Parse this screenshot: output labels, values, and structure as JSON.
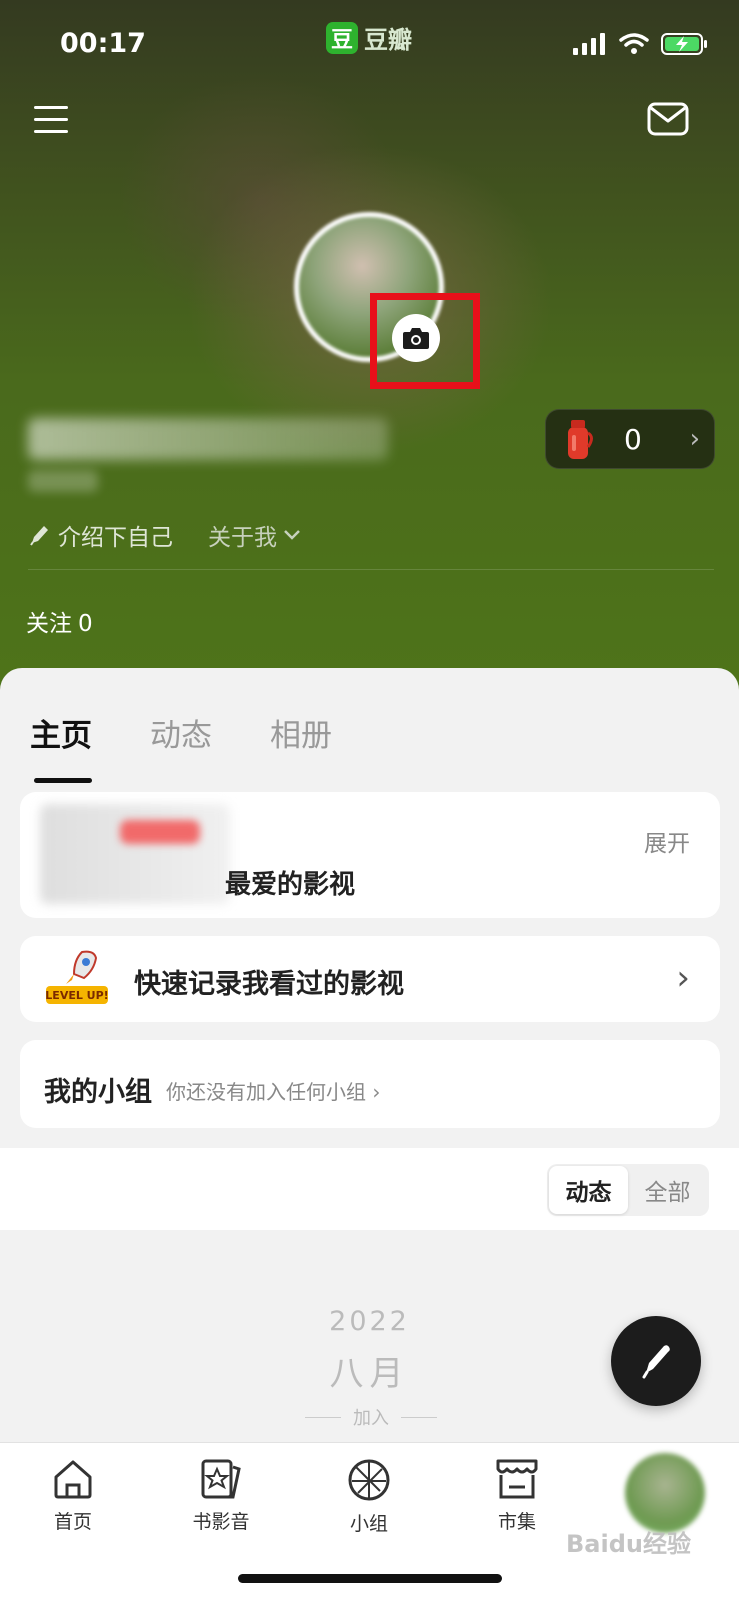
{
  "status_bar": {
    "time": "00:17",
    "app_badge": "豆瓣",
    "app_logo_char": "豆"
  },
  "header": {
    "menu_icon": "hamburger-icon",
    "mail_icon": "mail-icon"
  },
  "profile": {
    "camera_icon": "camera-icon",
    "points_value": "0",
    "intro_label": "介绍下自己",
    "about_label": "关于我",
    "follow_label": "关注",
    "follow_count": "0"
  },
  "tabs": [
    {
      "label": "主页",
      "active": true
    },
    {
      "label": "动态",
      "active": false
    },
    {
      "label": "相册",
      "active": false
    }
  ],
  "cards": {
    "favorites_text": "最爱的影视",
    "expand_label": "展开",
    "quick_record_label": "快速记录我看过的影视",
    "level_up_text": "LEVEL UP!",
    "groups_title": "我的小组",
    "groups_subtitle": "你还没有加入任何小组"
  },
  "filter": {
    "options": [
      "动态",
      "全部"
    ],
    "selected": "动态"
  },
  "timeline": {
    "year": "2022",
    "month": "八月",
    "event": "加入"
  },
  "bottom_nav": [
    {
      "label": "首页",
      "icon": "home-icon"
    },
    {
      "label": "书影音",
      "icon": "star-cards-icon"
    },
    {
      "label": "小组",
      "icon": "group-globe-icon"
    },
    {
      "label": "市集",
      "icon": "store-icon"
    }
  ],
  "watermark": "Baidu经验",
  "colors": {
    "highlight": "#e8101a",
    "brand_green": "#2eb22e"
  }
}
